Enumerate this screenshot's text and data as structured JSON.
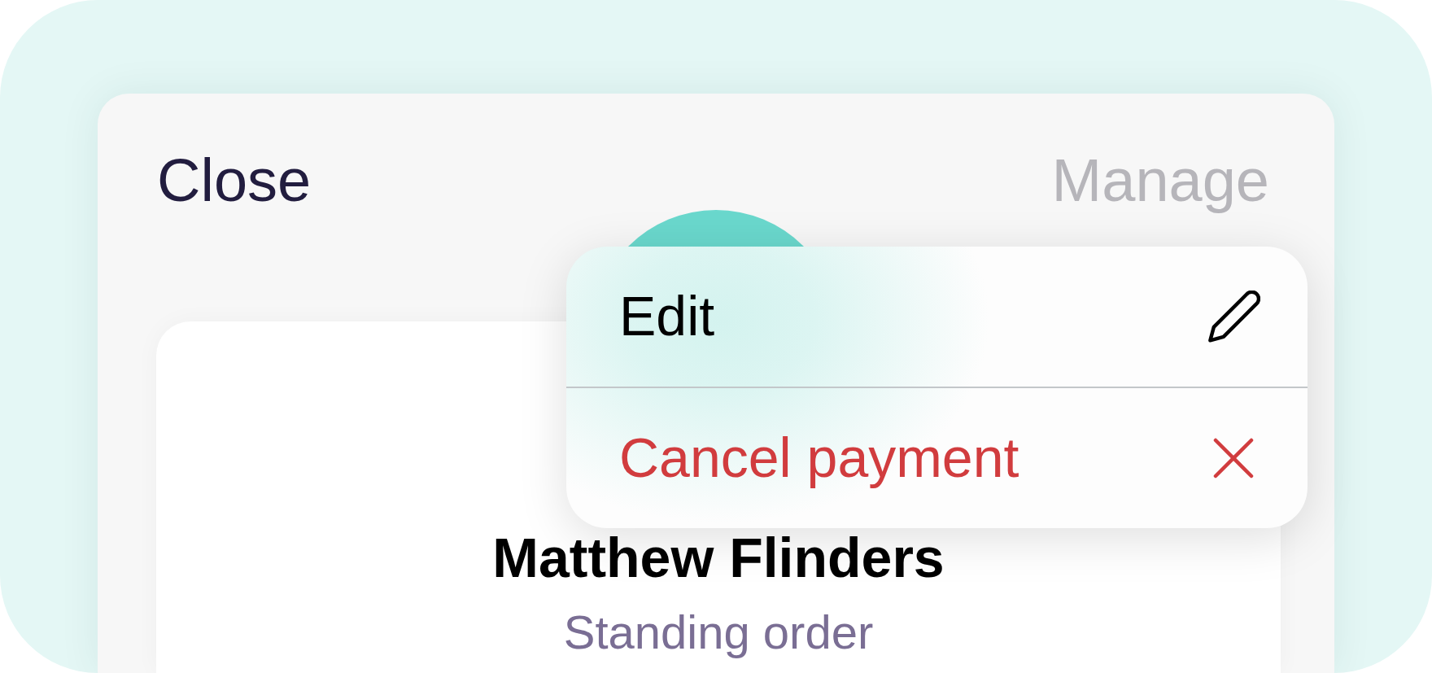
{
  "header": {
    "close_button": {
      "label": "Close"
    },
    "manage_button": {
      "label": "Manage",
      "disabled": true
    }
  },
  "payee": {
    "name": "Matthew Flinders",
    "subtitle": "Standing order"
  },
  "menu": {
    "items": [
      {
        "label": "Edit",
        "kind": "normal"
      },
      {
        "label": "Cancel payment",
        "kind": "destructive"
      }
    ]
  }
}
